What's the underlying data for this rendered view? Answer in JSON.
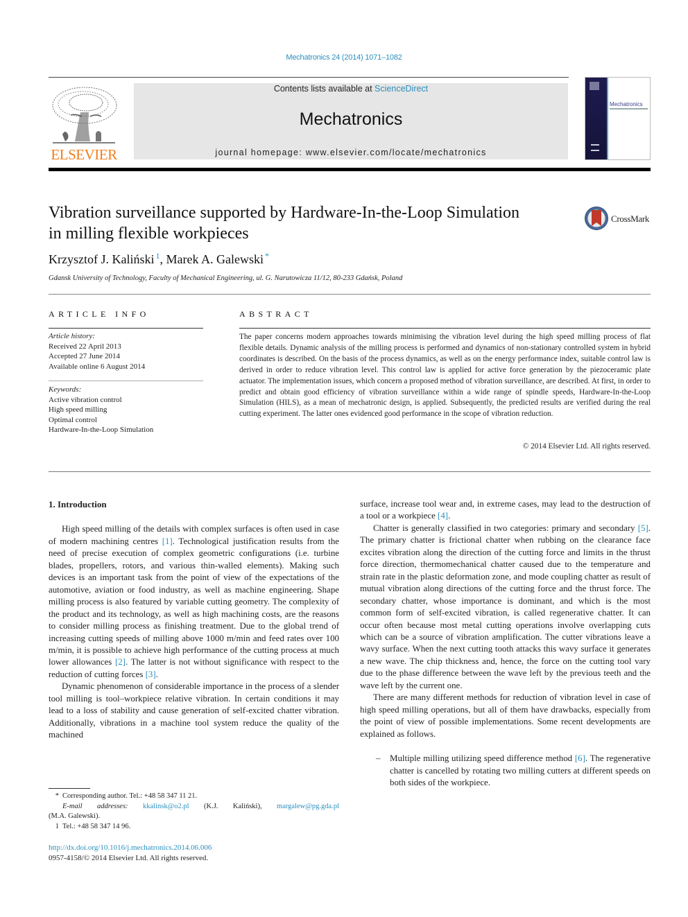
{
  "header": {
    "journal_reference": "Mechatronics 24 (2014) 1071–1082",
    "contents_prefix": "Contents lists available at ",
    "contents_link": "ScienceDirect",
    "journal_name": "Mechatronics",
    "homepage_prefix": "journal homepage: ",
    "homepage_url": "www.elsevier.com/locate/mechatronics",
    "publisher_logo_text": "ELSEVIER",
    "cover_title": "Mechatronics",
    "crossmark_label": "CrossMark"
  },
  "article": {
    "title_line1": "Vibration surveillance supported by Hardware-In-the-Loop Simulation",
    "title_line2": "in milling flexible workpieces",
    "authors": [
      {
        "name": "Krzysztof J. Kaliński",
        "mark": "1"
      },
      {
        "name": "Marek A. Galewski",
        "mark": "*"
      }
    ],
    "author_separator": ", ",
    "affiliation": "Gdansk University of Technology, Faculty of Mechanical Engineering, ul. G. Narutowicza 11/12, 80-233 Gdańsk, Poland"
  },
  "article_info": {
    "heading": "ARTICLE INFO",
    "history_label": "Article history:",
    "history": [
      "Received 22 April 2013",
      "Accepted 27 June 2014",
      "Available online 6 August 2014"
    ],
    "keywords_label": "Keywords:",
    "keywords": [
      "Active vibration control",
      "High speed milling",
      "Optimal control",
      "Hardware-In-the-Loop Simulation"
    ]
  },
  "abstract": {
    "heading": "ABSTRACT",
    "text": "The paper concerns modern approaches towards minimising the vibration level during the high speed milling process of flat flexible details. Dynamic analysis of the milling process is performed and dynamics of non-stationary controlled system in hybrid coordinates is described. On the basis of the process dynamics, as well as on the energy performance index, suitable control law is derived in order to reduce vibration level. This control law is applied for active force generation by the piezoceramic plate actuator. The implementation issues, which concern a proposed method of vibration surveillance, are described. At first, in order to predict and obtain good efficiency of vibration surveillance within a wide range of spindle speeds, Hardware-In-the-Loop Simulation (HILS), as a mean of mechatronic design, is applied. Subse­quently, the predicted results are verified during the real cutting experiment. The latter ones evidenced good performance in the scope of vibration reduction.",
    "copyright": "© 2014 Elsevier Ltd. All rights reserved."
  },
  "body": {
    "section_heading": "1. Introduction",
    "left_p1": {
      "a": "High speed milling of the details with complex surfaces is often used in case of modern machining centres ",
      "cite1": "[1]",
      "b": ". Technological justi­fication results from the need of precise execution of complex geo­metric configurations (i.e. turbine blades, propellers, rotors, and various thin-walled elements). Making such devices is an impor­tant task from the point of view of the expectations of the automo­tive, aviation or food industry, as well as machine engineering. Shape milling process is also featured by variable cutting geome­try. The complexity of the product and its technology, as well as high machining costs, are the reasons to consider milling process as finishing treatment. Due to the global trend of increasing cutting speeds of milling above 1000 m/min and feed rates over 100 m/min, it is possible to achieve high performance of the cutting process at much lower allowances ",
      "cite2": "[2]",
      "c": ". The latter is not without significance with respect to the reduction of cutting forces ",
      "cite3": "[3]",
      "d": "."
    },
    "left_p2": "Dynamic phenomenon of considerable importance in the pro­cess of a slender tool milling is tool–workpiece relative vibration. In certain conditions it may lead to a loss of stability and cause generation of self-excited chatter vibration. Additionally, vibra­tions in a machine tool system reduce the quality of the machined",
    "right_p0": {
      "a": "surface, increase tool wear and, in extreme cases, may lead to the destruction of a tool or a workpiece ",
      "cite": "[4]",
      "b": "."
    },
    "right_p1": {
      "a": "Chatter is generally classified in two categories: primary and secondary ",
      "cite": "[5]",
      "b": ". The primary chatter is frictional chatter when rub­bing on the clearance face excites vibration along the direction of the cutting force and limits in the thrust force direction, thermo­mechanical chatter caused due to the temperature and strain rate in the plastic deformation zone, and mode coupling chatter as result of mutual vibration along directions of the cutting force and the thrust force. The secondary chatter, whose importance is dominant, and which is the most common form of self-excited vibration, is called regenerative chatter. It can occur often because most metal cutting operations involve overlapping cuts which can be a source of vibration amplification. The cutter vibrations leave a wavy surface. When the next cutting tooth attacks this wavy sur­face it generates a new wave. The chip thickness and, hence, the force on the cutting tool vary due to the phase difference between the wave left by the previous teeth and the wave left by the current one."
    },
    "right_p2": "There are many different methods for reduction of vibration level in case of high speed milling operations, but all of them have drawbacks, especially from the point of view of possible imple­mentations. Some recent developments are explained as follows.",
    "bullet1": {
      "dash": "–",
      "a": "Multiple milling utilizing speed difference method ",
      "cite": "[6]",
      "b": ". The regenerative chatter is cancelled by rotating two milling cutters at different speeds on both sides of the workpiece."
    }
  },
  "footnotes": {
    "corresponding_mark": "*",
    "corresponding": "Corresponding author. Tel.: +48 58 347 11 21.",
    "email_label": "E-mail addresses:",
    "email1": "kkalinsk@o2.pl",
    "email1_owner": " (K.J. Kaliński), ",
    "email2": "margalew@pg.gda.pl",
    "email2_owner": "(M.A. Galewski).",
    "fn1_mark": "1",
    "fn1": "Tel.: +48 58 347 14 96."
  },
  "doi": {
    "url": "http://dx.doi.org/10.1016/j.mechatronics.2014.06.006",
    "issn_line": "0957-4158/© 2014 Elsevier Ltd. All rights reserved."
  },
  "colors": {
    "link": "#2a8fbd",
    "elsevier_orange": "#f07e1a",
    "masthead_bg": "#e6e6e6"
  }
}
